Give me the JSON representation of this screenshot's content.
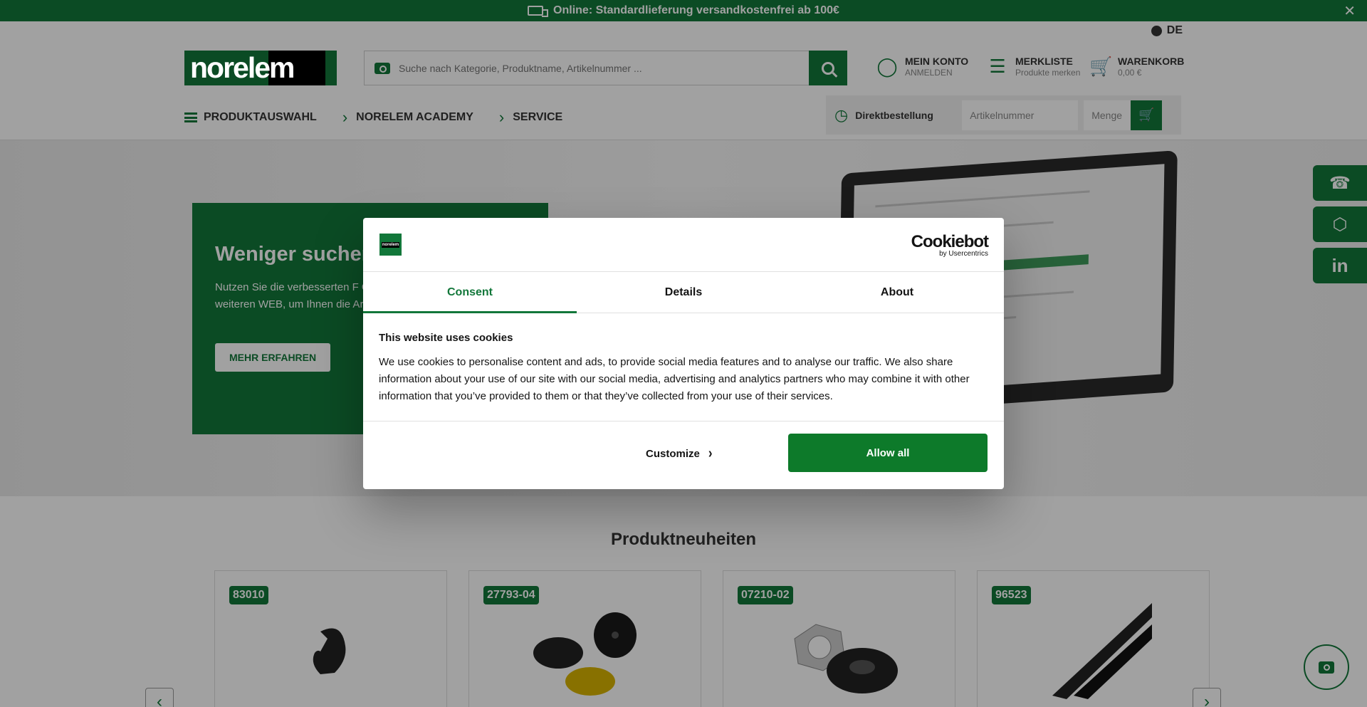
{
  "topbar": {
    "message": "Online: Standardlieferung versandkostenfrei ab 100€",
    "close_glyph": "✕"
  },
  "language": {
    "code": "DE"
  },
  "logo": {
    "text": "norelem"
  },
  "search": {
    "placeholder": "Suche nach Kategorie, Produktname, Artikelnummer ..."
  },
  "header": {
    "account": {
      "title": "MEIN KONTO",
      "subtitle": "ANMELDEN"
    },
    "wishlist": {
      "title": "MERKLISTE",
      "subtitle": "Produkte merken"
    },
    "cart": {
      "title": "WARENKORB",
      "subtitle": "0,00 €"
    }
  },
  "nav": {
    "items": [
      "PRODUKTAUSWAHL",
      "NORELEM ACADEMY",
      "SERVICE"
    ]
  },
  "direct_order": {
    "label": "Direktbestellung",
    "article_placeholder": "Artikelnummer",
    "quantity_placeholder": "Menge"
  },
  "hero": {
    "title": "Weniger suchen",
    "text": "Nutzen Sie die verbesserten F GREEN BOOK – jetzt weiteren WEB, um Ihnen die Arbeit leic",
    "button": "MEHR ERFAHREN"
  },
  "products": {
    "title": "Produktneuheiten",
    "cards": [
      {
        "badge": "83010"
      },
      {
        "badge": "27793-04"
      },
      {
        "badge": "07210-02"
      },
      {
        "badge": "96523"
      }
    ]
  },
  "cookie_dialog": {
    "brand": "Cookiebot",
    "brand_sub": "by Usercentrics",
    "tabs": [
      "Consent",
      "Details",
      "About"
    ],
    "active_tab": "Consent",
    "heading": "This website uses cookies",
    "body": "We use cookies to personalise content and ads, to provide social media features and to analyse our traffic. We also share information about your use of our site with our social media, advertising and analytics partners who may combine it with other information that you’ve provided to them or that they’ve collected from your use of their services.",
    "customize_label": "Customize",
    "allow_label": "Allow all"
  },
  "colors": {
    "brand_green": "#12773a",
    "allow_button": "#0d7a2a"
  }
}
